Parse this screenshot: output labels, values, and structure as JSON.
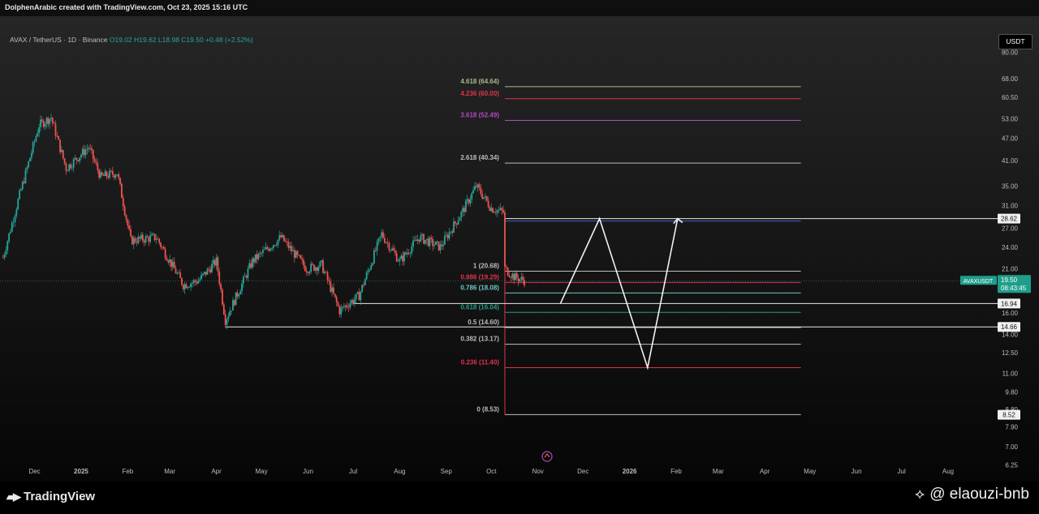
{
  "header": {
    "credit": "DolphenArabic created with TradingView.com, Oct 23, 2025 15:16 UTC"
  },
  "symbol_bar": {
    "title": "AVAX / TetherUS · 1D · Binance",
    "open": "O19.02",
    "high": "H19.62",
    "low": "L18.98",
    "close": "C19.50",
    "change": "+0.48 (+2.52%)"
  },
  "price_axis": {
    "unit": "USDT",
    "ticks": [
      "80.00",
      "68.00",
      "60.50",
      "53.00",
      "47.00",
      "41.00",
      "35.00",
      "31.00",
      "27.00",
      "24.00",
      "21.00",
      "16.00",
      "14.00",
      "12.50",
      "11.00",
      "9.80",
      "8.80",
      "7.90",
      "7.00",
      "6.25"
    ],
    "tags": [
      {
        "text": "28.62",
        "value": 28.62,
        "style": "white"
      },
      {
        "text": "16.94",
        "value": 16.94,
        "style": "white"
      },
      {
        "text": "14.66",
        "value": 14.66,
        "style": "white"
      },
      {
        "text": "8.52",
        "value": 8.52,
        "style": "white"
      }
    ],
    "current": {
      "label": "AVAXUSDT",
      "price": "19.50",
      "countdown": "08:43:45",
      "value": 19.5
    }
  },
  "time_axis": {
    "labels": [
      "Dec",
      "2025",
      "Feb",
      "Mar",
      "Apr",
      "May",
      "Jun",
      "Jul",
      "Aug",
      "Sep",
      "Oct",
      "Nov",
      "Dec",
      "2026",
      "Feb",
      "Mar",
      "Apr",
      "May",
      "Jun",
      "Jul",
      "Aug"
    ]
  },
  "chart_data": {
    "type": "candlestick",
    "symbol": "AVAXUSDT",
    "timeframe": "1D",
    "scale": "log",
    "y_range": [
      5.9,
      95
    ],
    "x_range": [
      "2024-11-08",
      "2026-08-28"
    ],
    "price_path": [
      {
        "date": "2024-11-10",
        "price": 22.5
      },
      {
        "date": "2024-11-20",
        "price": 32.0
      },
      {
        "date": "2024-12-04",
        "price": 51.0
      },
      {
        "date": "2024-12-12",
        "price": 53.5
      },
      {
        "date": "2024-12-22",
        "price": 39.0
      },
      {
        "date": "2025-01-06",
        "price": 44.5
      },
      {
        "date": "2025-01-14",
        "price": 37.0
      },
      {
        "date": "2025-01-25",
        "price": 38.0
      },
      {
        "date": "2025-02-03",
        "price": 25.0
      },
      {
        "date": "2025-02-20",
        "price": 25.5
      },
      {
        "date": "2025-03-10",
        "price": 19.0
      },
      {
        "date": "2025-03-20",
        "price": 19.5
      },
      {
        "date": "2025-04-01",
        "price": 22.0
      },
      {
        "date": "2025-04-07",
        "price": 15.3
      },
      {
        "date": "2025-04-25",
        "price": 22.0
      },
      {
        "date": "2025-05-14",
        "price": 25.5
      },
      {
        "date": "2025-05-31",
        "price": 21.0
      },
      {
        "date": "2025-06-10",
        "price": 21.5
      },
      {
        "date": "2025-06-22",
        "price": 16.2
      },
      {
        "date": "2025-07-05",
        "price": 17.8
      },
      {
        "date": "2025-07-20",
        "price": 26.0
      },
      {
        "date": "2025-08-01",
        "price": 22.0
      },
      {
        "date": "2025-08-14",
        "price": 25.5
      },
      {
        "date": "2025-08-28",
        "price": 24.0
      },
      {
        "date": "2025-09-12",
        "price": 30.0
      },
      {
        "date": "2025-09-21",
        "price": 35.0
      },
      {
        "date": "2025-10-01",
        "price": 30.5
      },
      {
        "date": "2025-10-09",
        "price": 29.8
      },
      {
        "date": "2025-10-10",
        "price": 21.0
      },
      {
        "date": "2025-10-16",
        "price": 20.0
      },
      {
        "date": "2025-10-23",
        "price": 19.5
      }
    ],
    "fib_levels": [
      {
        "ratio": "4.618",
        "value": 64.64,
        "label": "4.618 (64.64)",
        "color": "#a6bc89"
      },
      {
        "ratio": "4.236",
        "value": 60.0,
        "label": "4.236 (60.00)",
        "color": "#e0334c"
      },
      {
        "ratio": "3.618",
        "value": 52.49,
        "label": "3.618 (52.49)",
        "color": "#b04bc0"
      },
      {
        "ratio": "2.618",
        "value": 40.34,
        "label": "2.618 (40.34)",
        "color": "#bdbdbd"
      },
      {
        "ratio": "1",
        "value": 20.68,
        "label": "1 (20.68)",
        "color": "#bdbdbd"
      },
      {
        "ratio": "0.886",
        "value": 19.29,
        "label": "0.886 (19.29)",
        "color": "#e0334c"
      },
      {
        "ratio": "0.786",
        "value": 18.08,
        "label": "0.786 (18.08)",
        "color": "#6fc7c4"
      },
      {
        "ratio": "0.618",
        "value": 16.04,
        "label": "0.618 (16.04)",
        "color": "#1f9e8b"
      },
      {
        "ratio": "0.5",
        "value": 14.6,
        "label": "0.5 (14.60)",
        "color": "#bdbdbd"
      },
      {
        "ratio": "0.382",
        "value": 13.17,
        "label": "0.382 (13.17)",
        "color": "#bdbdbd"
      },
      {
        "ratio": "0.236",
        "value": 11.4,
        "label": "0.236 (11.40)",
        "color": "#e0334c"
      },
      {
        "ratio": "0",
        "value": 8.53,
        "label": "0 (8.53)",
        "color": "#bdbdbd"
      }
    ],
    "support_lines": [
      {
        "from": "2025-07-01",
        "value": 16.94
      },
      {
        "from": "2025-04-07",
        "value": 14.66
      }
    ],
    "resistance_line": {
      "from": "2025-10-10",
      "value": 28.62
    },
    "projection": [
      {
        "date": "2025-11-16",
        "price": 16.94
      },
      {
        "date": "2025-12-12",
        "price": 28.62
      },
      {
        "date": "2026-01-13",
        "price": 11.4
      },
      {
        "date": "2026-02-02",
        "price": 28.62
      }
    ],
    "fib_anchor": {
      "date": "2025-10-10",
      "high": 28.62,
      "low": 8.53
    }
  },
  "footer": {
    "brand": "TradingView",
    "handle": "@ elaouzi-bnb"
  },
  "colors": {
    "bull": "#26a69a",
    "bear": "#ef5350",
    "background_top": "#262626",
    "background_bottom": "#060606"
  }
}
